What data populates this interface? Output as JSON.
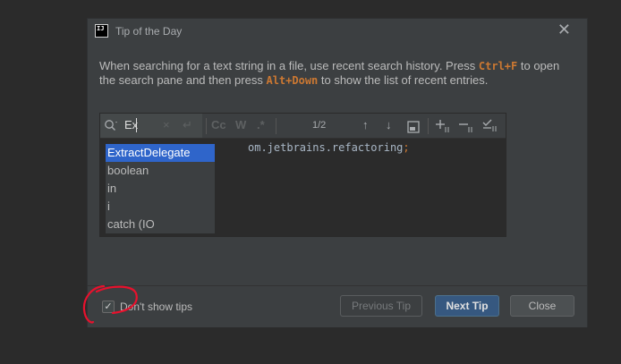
{
  "dialog": {
    "title": "Tip of the Day",
    "app_icon_text": "IJ",
    "close_glyph": "✕",
    "tip": {
      "part1": "When searching for a text string in a file, use recent search history. Press ",
      "key1": "Ctrl+F",
      "part2": " to open the search pane and then press ",
      "key2": "Alt+Down",
      "part3": " to show the list of recent entries."
    }
  },
  "find_bar": {
    "search_icon": "search-icon",
    "search_value": "Ex",
    "clear_glyph": "×",
    "regex_return_glyph": "↵",
    "match_case": "Cc",
    "whole_word": "W",
    "regex": ".*",
    "match_count": "1/2",
    "up_arrow": "↑",
    "down_arrow": "↓"
  },
  "editor": {
    "code_visible": "om.jetbrains.refactoring",
    "code_semicolon": ";"
  },
  "history_popup": {
    "items": [
      {
        "label": "ExtractDelegate",
        "selected": true
      },
      {
        "label": "boolean"
      },
      {
        "label": "in"
      },
      {
        "label": "i"
      },
      {
        "label": "catch (IO"
      }
    ]
  },
  "footer": {
    "checkbox_checked": true,
    "dont_show_label": "Don't show tips",
    "prev_button": "Previous Tip",
    "next_button": "Next Tip",
    "close_button": "Close"
  },
  "colors": {
    "background": "#2b2b2b",
    "dialog": "#3c3f41",
    "accent_blue": "#365880",
    "selection": "#2f65ca",
    "keyword_orange": "#cc7832",
    "annotation_red": "#e8112d"
  }
}
